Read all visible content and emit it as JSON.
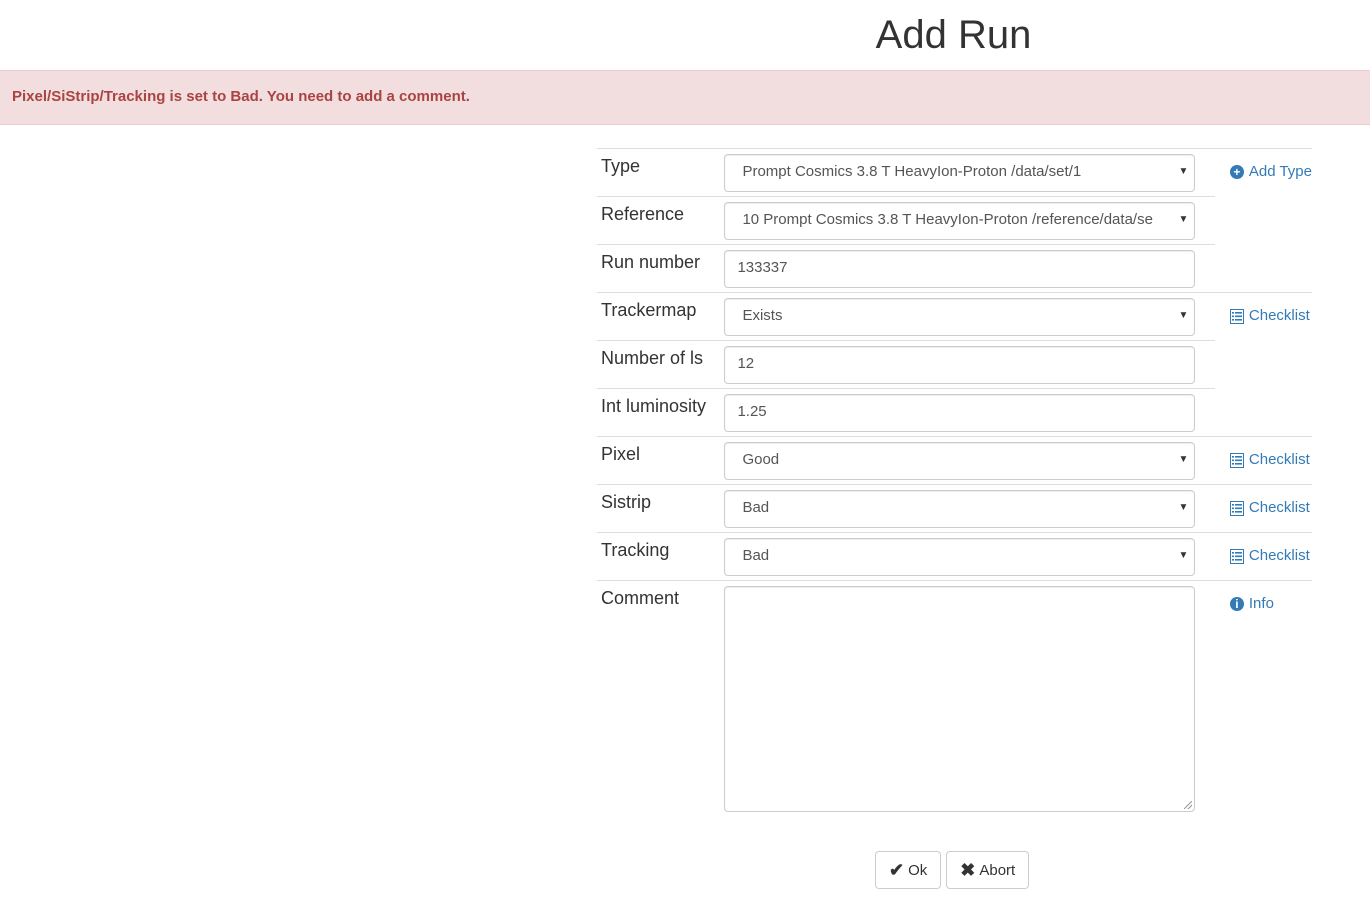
{
  "page": {
    "title": "Add Run"
  },
  "alert": {
    "message": "Pixel/SiStrip/Tracking is set to Bad. You need to add a comment."
  },
  "form": {
    "type": {
      "label": "Type",
      "value": "Prompt Cosmics 3.8 T HeavyIon-Proton /data/set/1",
      "action": "Add Type"
    },
    "reference": {
      "label": "Reference",
      "value": "10 Prompt Cosmics 3.8 T HeavyIon-Proton /reference/data/se"
    },
    "run_number": {
      "label": "Run number",
      "value": "133337"
    },
    "trackermap": {
      "label": "Trackermap",
      "value": "Exists",
      "action": "Checklist"
    },
    "number_of_ls": {
      "label": "Number of ls",
      "value": "12"
    },
    "int_luminosity": {
      "label": "Int luminosity",
      "value": "1.25"
    },
    "pixel": {
      "label": "Pixel",
      "value": "Good",
      "action": "Checklist"
    },
    "sistrip": {
      "label": "Sistrip",
      "value": "Bad",
      "action": "Checklist"
    },
    "tracking": {
      "label": "Tracking",
      "value": "Bad",
      "action": "Checklist"
    },
    "comment": {
      "label": "Comment",
      "value": "",
      "action": "Info"
    }
  },
  "buttons": {
    "ok": "Ok",
    "abort": "Abort"
  },
  "colors": {
    "link": "#337ab7",
    "alert_bg": "#f2dede",
    "alert_text": "#a94442"
  },
  "icons": {
    "add_type": "plus-circle-icon",
    "checklist": "list-icon",
    "info": "info-circle-icon",
    "ok": "checkmark-icon",
    "abort": "x-icon",
    "select": "caret-down-icon"
  }
}
